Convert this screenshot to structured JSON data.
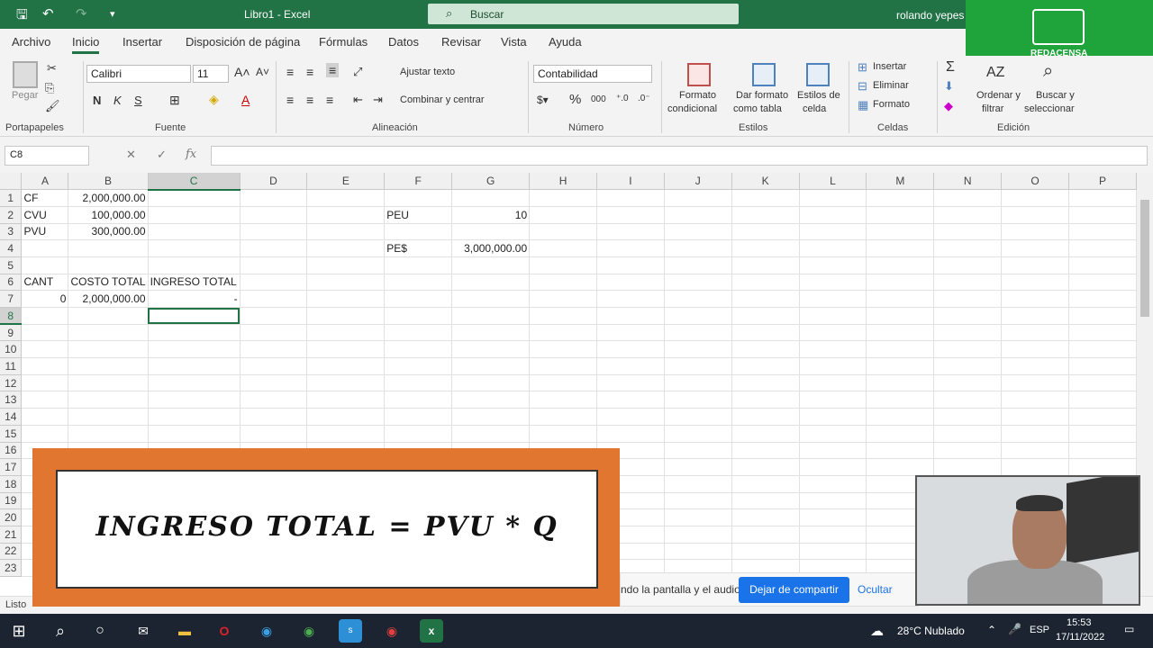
{
  "titlebar": {
    "doc_title": "Libro1 - Excel",
    "search_label": "Buscar",
    "user": "rolando yepes",
    "logo_text": "REDACENSA"
  },
  "menu": [
    "Archivo",
    "Inicio",
    "Insertar",
    "Disposición de página",
    "Fórmulas",
    "Datos",
    "Revisar",
    "Vista",
    "Ayuda"
  ],
  "ribbon": {
    "paste": "Pegar",
    "groups": {
      "portapapeles": "Portapapeles",
      "fuente": "Fuente",
      "alineacion": "Alineación",
      "numero": "Número",
      "estilos": "Estilos",
      "celdas": "Celdas",
      "edicion": "Edición"
    },
    "font_name": "Calibri",
    "font_size": "11",
    "wrap_text": "Ajustar texto",
    "merge_center": "Combinar y centrar",
    "number_format": "Contabilidad",
    "cond_format": [
      "Formato",
      "condicional"
    ],
    "format_table": [
      "Dar formato",
      "como tabla"
    ],
    "cell_styles": [
      "Estilos de",
      "celda"
    ],
    "insert": "Insertar",
    "delete": "Eliminar",
    "format": "Formato",
    "sort": [
      "Ordenar y",
      "filtrar"
    ],
    "find": [
      "Buscar y",
      "seleccionar"
    ]
  },
  "formula_bar": {
    "name_box": "C8",
    "fx": "fx",
    "content": ""
  },
  "grid": {
    "columns": [
      "A",
      "B",
      "C",
      "D",
      "E",
      "F",
      "G",
      "H",
      "I",
      "J",
      "K",
      "L",
      "M",
      "N",
      "O",
      "P"
    ],
    "rows": [
      [
        "1",
        "CF",
        "2,000,000.00",
        "",
        "",
        "",
        "",
        "",
        "",
        "",
        "",
        "",
        "",
        "",
        "",
        "",
        ""
      ],
      [
        "2",
        "CVU",
        "100,000.00",
        "",
        "",
        "",
        "PEU",
        "10",
        "",
        "",
        "",
        "",
        "",
        "",
        "",
        "",
        ""
      ],
      [
        "3",
        "PVU",
        "300,000.00",
        "",
        "",
        "",
        "",
        "",
        "",
        "",
        "",
        "",
        "",
        "",
        "",
        "",
        ""
      ],
      [
        "4",
        "",
        "",
        "",
        "",
        "",
        "PE$",
        "3,000,000.00",
        "",
        "",
        "",
        "",
        "",
        "",
        "",
        "",
        ""
      ],
      [
        "5",
        "",
        "",
        "",
        "",
        "",
        "",
        "",
        "",
        "",
        "",
        "",
        "",
        "",
        "",
        "",
        ""
      ],
      [
        "6",
        "CANT",
        "COSTO TOTAL",
        "INGRESO TOTAL",
        "",
        "",
        "",
        "",
        "",
        "",
        "",
        "",
        "",
        "",
        "",
        "",
        ""
      ],
      [
        "7",
        "0",
        "2,000,000.00",
        "-",
        "",
        "",
        "",
        "",
        "",
        "",
        "",
        "",
        "",
        "",
        "",
        "",
        ""
      ],
      [
        "8",
        "",
        "",
        "",
        "",
        "",
        "",
        "",
        "",
        "",
        "",
        "",
        "",
        "",
        "",
        "",
        ""
      ],
      [
        "9",
        "",
        "",
        "",
        "",
        "",
        "",
        "",
        "",
        "",
        "",
        "",
        "",
        "",
        "",
        "",
        ""
      ],
      [
        "10",
        "",
        "",
        "",
        "",
        "",
        "",
        "",
        "",
        "",
        "",
        "",
        "",
        "",
        "",
        "",
        ""
      ],
      [
        "11",
        "",
        "",
        "",
        "",
        "",
        "",
        "",
        "",
        "",
        "",
        "",
        "",
        "",
        "",
        "",
        ""
      ],
      [
        "12",
        "",
        "",
        "",
        "",
        "",
        "",
        "",
        "",
        "",
        "",
        "",
        "",
        "",
        "",
        "",
        ""
      ],
      [
        "13",
        "",
        "",
        "",
        "",
        "",
        "",
        "",
        "",
        "",
        "",
        "",
        "",
        "",
        "",
        "",
        ""
      ],
      [
        "14",
        "",
        "",
        "",
        "",
        "",
        "",
        "",
        "",
        "",
        "",
        "",
        "",
        "",
        "",
        "",
        ""
      ],
      [
        "15",
        "",
        "",
        "",
        "",
        "",
        "",
        "",
        "",
        "",
        "",
        "",
        "",
        "",
        "",
        "",
        ""
      ],
      [
        "16",
        "",
        "",
        "",
        "",
        "",
        "",
        "",
        "",
        "",
        "",
        "",
        "",
        "",
        "",
        "",
        ""
      ],
      [
        "17",
        "",
        "",
        "",
        "",
        "",
        "",
        "",
        "",
        "",
        "",
        "",
        "",
        "",
        "",
        "",
        ""
      ],
      [
        "18",
        "",
        "",
        "",
        "",
        "",
        "",
        "",
        "",
        "",
        "",
        "",
        "",
        "",
        "",
        "",
        ""
      ],
      [
        "19",
        "",
        "",
        "",
        "",
        "",
        "",
        "",
        "",
        "",
        "",
        "",
        "",
        "",
        "",
        "",
        ""
      ],
      [
        "20",
        "",
        "",
        "",
        "",
        "",
        "",
        "",
        "",
        "",
        "",
        "",
        "",
        "",
        "",
        "",
        ""
      ],
      [
        "21",
        "",
        "",
        "",
        "",
        "",
        "",
        "",
        "",
        "",
        "",
        "",
        "",
        "",
        "",
        "",
        ""
      ],
      [
        "22",
        "",
        "",
        "",
        "",
        "",
        "",
        "",
        "",
        "",
        "",
        "",
        "",
        "",
        "",
        "",
        ""
      ],
      [
        "23",
        "",
        "",
        "",
        "",
        "",
        "",
        "",
        "",
        "",
        "",
        "",
        "",
        "",
        "",
        "",
        ""
      ]
    ],
    "selected_cell": "C8"
  },
  "status": "Listo",
  "overlay": {
    "formula": "INGRESO TOTAL = PVU  * Q"
  },
  "share": {
    "message": "ndo la pantalla y el audio.",
    "stop": "Dejar de compartir",
    "hide": "Ocultar"
  },
  "taskbar": {
    "weather": "28°C  Nublado",
    "lang": "ESP",
    "time": "15:53",
    "date": "17/11/2022"
  }
}
